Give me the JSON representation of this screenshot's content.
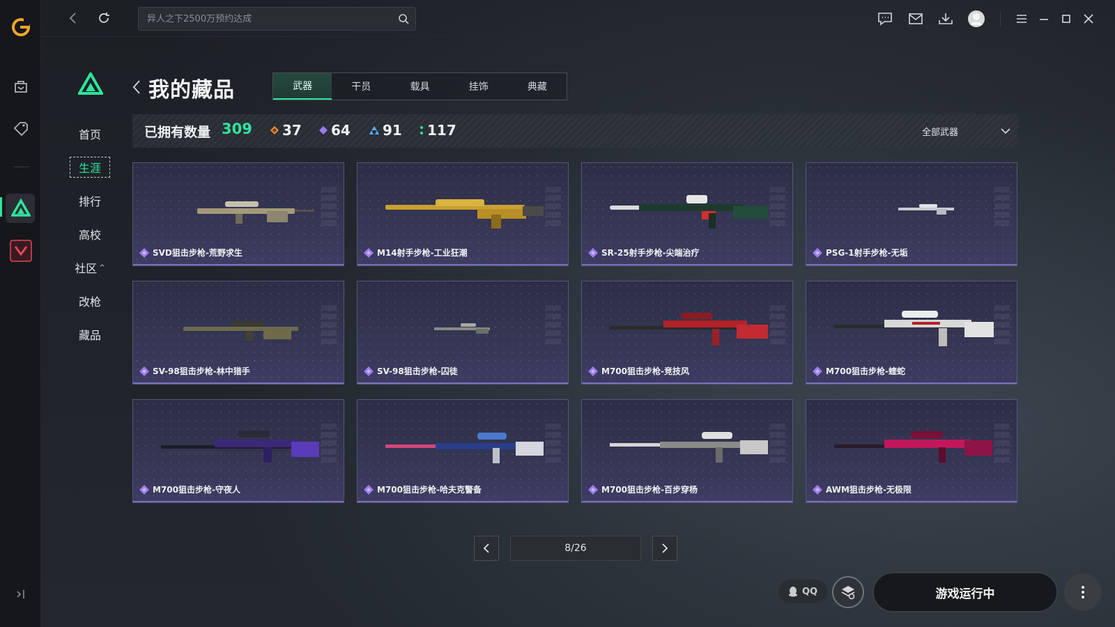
{
  "search": {
    "placeholder": "异人之下2500万预约达成"
  },
  "sidebar": {
    "items": [
      {
        "icon": "game-library-icon"
      },
      {
        "icon": "tag-icon"
      },
      {
        "icon": "delta-force-app-icon"
      },
      {
        "icon": "valorant-app-icon"
      }
    ],
    "collapse_icon": "collapse-sidebar-icon"
  },
  "topbar": {
    "icons": [
      "chat-icon",
      "mail-icon",
      "download-icon",
      "avatar",
      "menu-icon",
      "minimize-icon",
      "maximize-icon",
      "close-icon"
    ]
  },
  "subnav": {
    "items": [
      {
        "label": "首页"
      },
      {
        "label": "生涯"
      },
      {
        "label": "排行"
      },
      {
        "label": "高校"
      },
      {
        "label": "社区"
      },
      {
        "label": "改枪"
      },
      {
        "label": "藏品"
      }
    ],
    "active_index": 1
  },
  "page": {
    "title": "我的藏品"
  },
  "tabs": [
    {
      "label": "武器"
    },
    {
      "label": "干员"
    },
    {
      "label": "载具"
    },
    {
      "label": "挂饰"
    },
    {
      "label": "典藏"
    }
  ],
  "stats": {
    "owned_label": "已拥有数量",
    "owned_value": "309",
    "orange_count": "37",
    "purple_count": "64",
    "blue_count": "91",
    "green_count": "117"
  },
  "filter": {
    "label": "全部武器"
  },
  "items": [
    {
      "name": "SVD狙击步枪-荒野求生"
    },
    {
      "name": "M14射手步枪-工业狂潮"
    },
    {
      "name": "SR-25射手步枪-尖端治疗"
    },
    {
      "name": "PSG-1射手步枪-无垢"
    },
    {
      "name": "SV-98狙击步枪-林中猎手"
    },
    {
      "name": "SV-98狙击步枪-囚徒"
    },
    {
      "name": "M700狙击步枪-竞技风"
    },
    {
      "name": "M700狙击步枪-蝰蛇"
    },
    {
      "name": "M700狙击步枪-守夜人"
    },
    {
      "name": "M700狙击步枪-哈夫克警备"
    },
    {
      "name": "M700狙击步枪-百步穿杨"
    },
    {
      "name": "AWM狙击步枪-无极限"
    }
  ],
  "pagination": {
    "page_text": "8/26"
  },
  "footer": {
    "qq_label": "QQ",
    "play_label": "游戏运行中"
  },
  "colors": {
    "accent": "#2ee59d",
    "rarity_purple": "#9b7cf0",
    "rarity_orange": "#e8883a",
    "rarity_blue": "#5aa7ff"
  }
}
